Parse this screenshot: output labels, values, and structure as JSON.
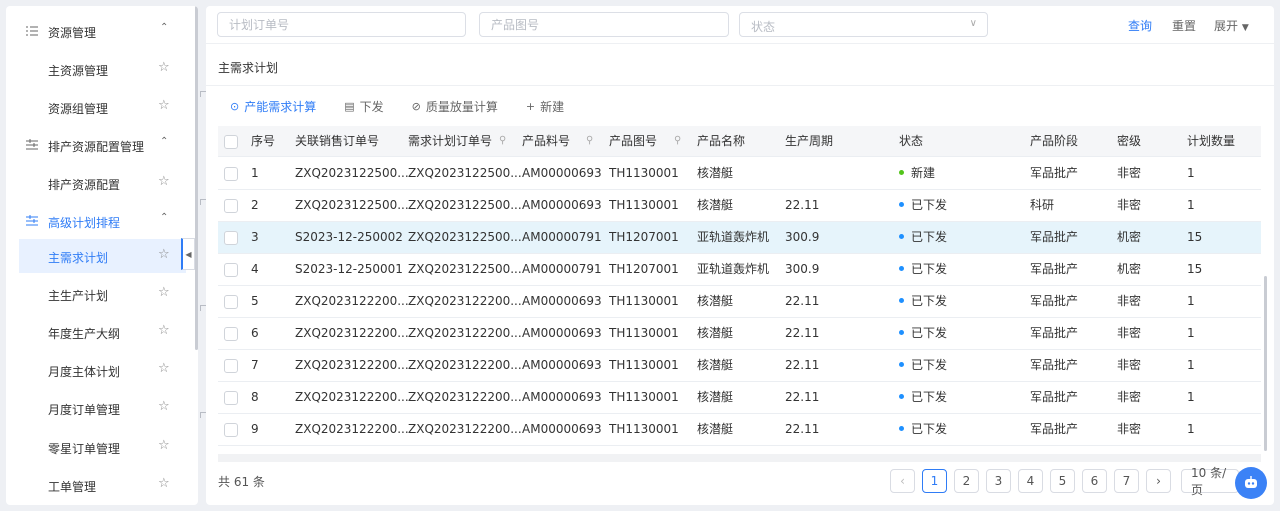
{
  "sidebar": {
    "groups": [
      {
        "label": "资源管理",
        "icon": "list-icon"
      },
      {
        "label": "排产资源配置管理",
        "icon": "settings-list-icon"
      },
      {
        "label": "高级计划排程",
        "icon": "settings-list-icon"
      }
    ],
    "items": [
      {
        "label": "主资源管理"
      },
      {
        "label": "资源组管理"
      },
      {
        "label": "排产资源配置"
      },
      {
        "label": "主需求计划"
      },
      {
        "label": "主生产计划"
      },
      {
        "label": "年度生产大纲"
      },
      {
        "label": "月度主体计划"
      },
      {
        "label": "月度订单管理"
      },
      {
        "label": "零星订单管理"
      },
      {
        "label": "工单管理"
      }
    ]
  },
  "filters": {
    "plan_order_placeholder": "计划订单号",
    "product_drawing_placeholder": "产品图号",
    "status_placeholder": "状态",
    "query_label": "查询",
    "reset_label": "重置",
    "expand_label": "展开"
  },
  "page_title": "主需求计划",
  "toolbar": {
    "capacity_calc": "产能需求计算",
    "issue": "下发",
    "quality_calc": "质量放量计算",
    "create": "新建"
  },
  "table": {
    "headers": [
      "序号",
      "关联销售订单号",
      "需求计划订单号",
      "产品料号",
      "产品图号",
      "产品名称",
      "生产周期",
      "状态",
      "产品阶段",
      "密级",
      "计划数量"
    ],
    "rows": [
      [
        "1",
        "ZXQ2023122500...",
        "ZXQ2023122500...",
        "AM00000693",
        "TH1130001",
        "核潜艇",
        "",
        "新建",
        "军品批产",
        "非密",
        "1"
      ],
      [
        "2",
        "ZXQ2023122500...",
        "ZXQ2023122500...",
        "AM00000693",
        "TH1130001",
        "核潜艇",
        "22.11",
        "已下发",
        "科研",
        "非密",
        "1"
      ],
      [
        "3",
        "S2023-12-250002",
        "ZXQ2023122500...",
        "AM00000791",
        "TH1207001",
        "亚轨道轰炸机",
        "300.9",
        "已下发",
        "军品批产",
        "机密",
        "15"
      ],
      [
        "4",
        "S2023-12-250001",
        "ZXQ2023122500...",
        "AM00000791",
        "TH1207001",
        "亚轨道轰炸机",
        "300.9",
        "已下发",
        "军品批产",
        "机密",
        "15"
      ],
      [
        "5",
        "ZXQ2023122200...",
        "ZXQ2023122200...",
        "AM00000693",
        "TH1130001",
        "核潜艇",
        "22.11",
        "已下发",
        "军品批产",
        "非密",
        "1"
      ],
      [
        "6",
        "ZXQ2023122200...",
        "ZXQ2023122200...",
        "AM00000693",
        "TH1130001",
        "核潜艇",
        "22.11",
        "已下发",
        "军品批产",
        "非密",
        "1"
      ],
      [
        "7",
        "ZXQ2023122200...",
        "ZXQ2023122200...",
        "AM00000693",
        "TH1130001",
        "核潜艇",
        "22.11",
        "已下发",
        "军品批产",
        "非密",
        "1"
      ],
      [
        "8",
        "ZXQ2023122200...",
        "ZXQ2023122200...",
        "AM00000693",
        "TH1130001",
        "核潜艇",
        "22.11",
        "已下发",
        "军品批产",
        "非密",
        "1"
      ],
      [
        "9",
        "ZXQ2023122200...",
        "ZXQ2023122200...",
        "AM00000693",
        "TH1130001",
        "核潜艇",
        "22.11",
        "已下发",
        "军品批产",
        "非密",
        "1"
      ]
    ],
    "status_colors": {
      "新建": "#52c41a",
      "已下发": "#1e90ff"
    },
    "highlight_row": 3
  },
  "pagination": {
    "total": "共 61 条",
    "pages": [
      "1",
      "2",
      "3",
      "4",
      "5",
      "6",
      "7"
    ],
    "current": "1",
    "page_size": "10 条/页"
  },
  "colors": {
    "accent": "#2f7cf6",
    "highlight": "#e6f4fb"
  }
}
